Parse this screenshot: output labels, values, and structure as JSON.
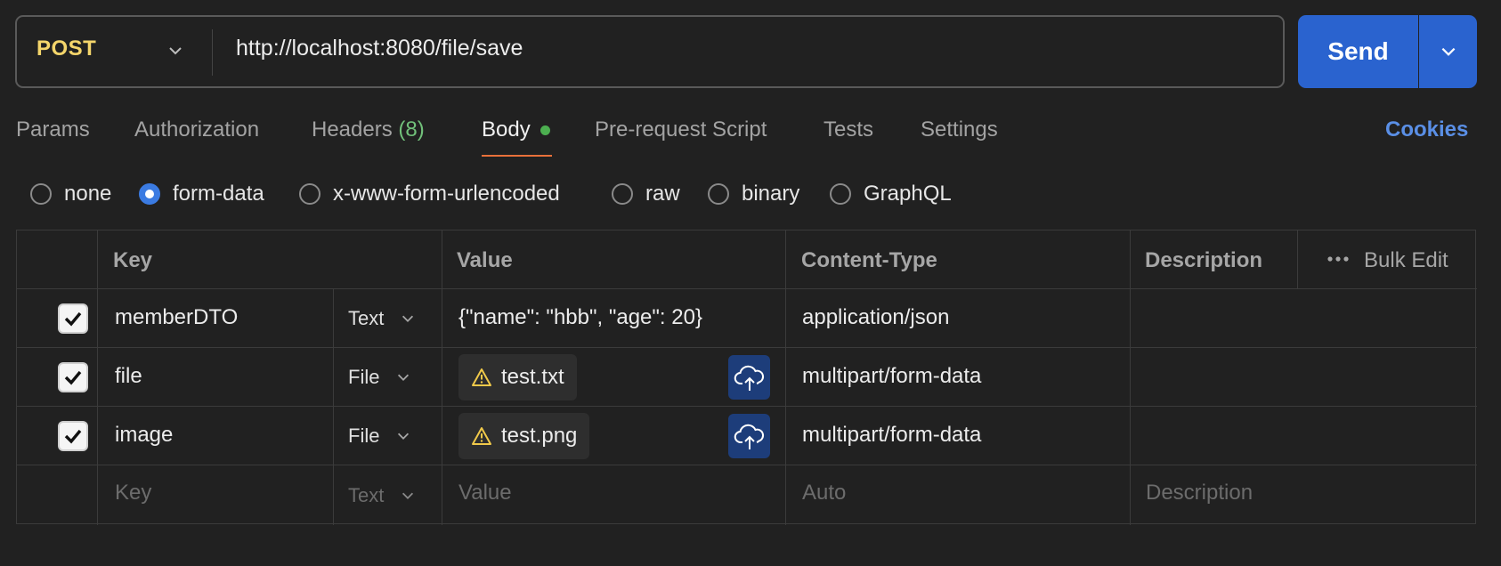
{
  "request": {
    "method": "POST",
    "url": "http://localhost:8080/file/save",
    "send_label": "Send"
  },
  "tabs": [
    {
      "label": "Params"
    },
    {
      "label": "Authorization"
    },
    {
      "label": "Headers",
      "count": "(8)"
    },
    {
      "label": "Body"
    },
    {
      "label": "Pre-request Script"
    },
    {
      "label": "Tests"
    },
    {
      "label": "Settings"
    }
  ],
  "cookies_label": "Cookies",
  "body_types": {
    "selected": "form-data",
    "options": [
      "none",
      "form-data",
      "x-www-form-urlencoded",
      "raw",
      "binary",
      "GraphQL"
    ]
  },
  "table": {
    "headers": {
      "key": "Key",
      "value": "Value",
      "content_type": "Content-Type",
      "description": "Description"
    },
    "bulk_edit": "Bulk Edit",
    "rows": [
      {
        "checked": true,
        "key": "memberDTO",
        "type": "Text",
        "value": "{\"name\": \"hbb\", \"age\": 20}",
        "content_type": "application/json",
        "description": ""
      },
      {
        "checked": true,
        "key": "file",
        "type": "File",
        "value": "test.txt",
        "content_type": "multipart/form-data",
        "description": ""
      },
      {
        "checked": true,
        "key": "image",
        "type": "File",
        "value": "test.png",
        "content_type": "multipart/form-data",
        "description": ""
      }
    ],
    "placeholder": {
      "key": "Key",
      "type": "Text",
      "value": "Value",
      "content_type": "Auto",
      "description": "Description"
    }
  },
  "colors": {
    "background": "#212121",
    "method": "#f4d56b",
    "send": "#2a63cf",
    "accent_link": "#5a8fe6",
    "active_tab_underline": "#e8703a",
    "body_dot": "#4caf50",
    "warning": "#f0c94a"
  }
}
